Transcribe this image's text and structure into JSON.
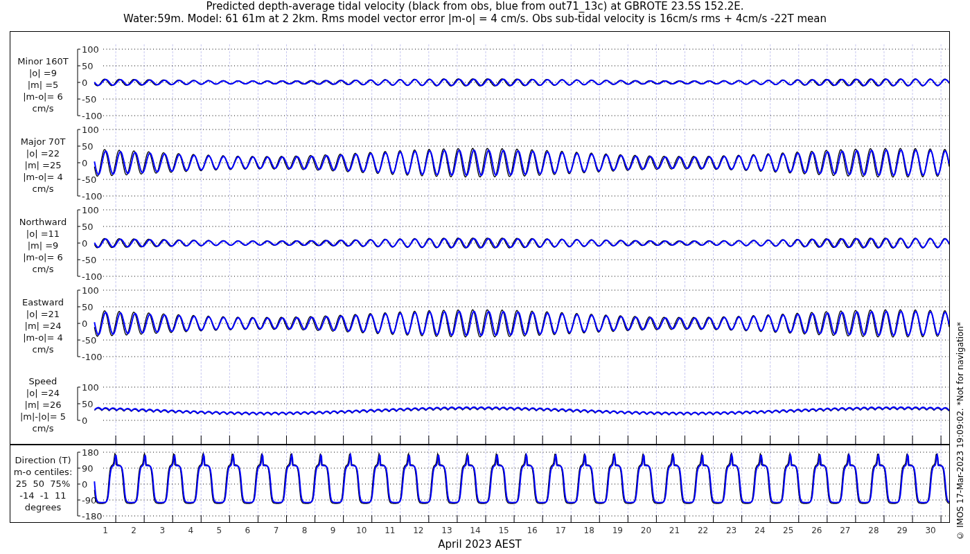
{
  "title": [
    "Predicted depth-average tidal velocity (black from obs, blue from out71_13c) at GBROTE 23.5S 152.2E.",
    "Water:59m. Model: 61 61m at 2 2km. Rms model vector error |m-o| = 4 cm/s. Obs sub-tidal velocity is 16cm/s rms + 4cm/s -22T mean"
  ],
  "panels": [
    {
      "kind": "velocity",
      "label": [
        "Minor 160T",
        "|o| =9",
        "|m| =5",
        "|m-o|= 6",
        "cm/s"
      ],
      "yticks": [
        "100",
        "50",
        "0",
        "-50",
        "-100"
      ]
    },
    {
      "kind": "velocity",
      "label": [
        "Major 70T",
        "|o| =22",
        "|m| =25",
        "|m-o|= 4",
        "cm/s"
      ],
      "yticks": [
        "100",
        "50",
        "0",
        "-50",
        "-100"
      ]
    },
    {
      "kind": "velocity",
      "label": [
        "Northward",
        "|o| =11",
        "|m| =9",
        "|m-o|= 6",
        "cm/s"
      ],
      "yticks": [
        "100",
        "50",
        "0",
        "-50",
        "-100"
      ]
    },
    {
      "kind": "velocity",
      "label": [
        "Eastward",
        "|o| =21",
        "|m| =24",
        "|m-o|= 4",
        "cm/s"
      ],
      "yticks": [
        "100",
        "50",
        "0",
        "-50",
        "-100"
      ]
    },
    {
      "kind": "speed",
      "label": [
        "Speed",
        "|o| =24",
        "|m| =26",
        "|m|-|o|= 5",
        "cm/s"
      ],
      "yticks": [
        "100",
        "50",
        "0"
      ]
    }
  ],
  "direction": {
    "label": [
      "Direction (T)",
      "m-o centiles:",
      "25  50  75%",
      "-14  -1  11",
      "degrees"
    ],
    "yticks": [
      "180",
      "90",
      "0",
      "-90",
      "-180"
    ]
  },
  "xticks": [
    "1",
    "2",
    "3",
    "4",
    "5",
    "6",
    "7",
    "8",
    "9",
    "10",
    "11",
    "12",
    "13",
    "14",
    "15",
    "16",
    "17",
    "18",
    "19",
    "20",
    "21",
    "22",
    "23",
    "24",
    "25",
    "26",
    "27",
    "28",
    "29",
    "30"
  ],
  "xlabel": "April 2023 AEST",
  "footer": "© IMOS 17-Mar-2023 19:09:02. *Not for navigation*"
}
